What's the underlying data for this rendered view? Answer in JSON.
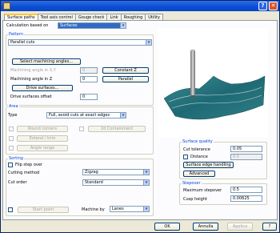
{
  "dialog": {
    "help_glyph": "?",
    "close_glyph": "✕"
  },
  "tabs": [
    "Surface paths",
    "Tool axis control",
    "Gouge check",
    "Link",
    "Roughing",
    "Utility"
  ],
  "calc": {
    "label": "Calculation based on",
    "value": "Surfaces"
  },
  "pattern": {
    "title": "Pattern",
    "type": "Parallel cuts",
    "select_angles_btn": "Select machining angles...",
    "angle_xy_label": "Machining angle in X,Y",
    "angle_xy_value": "0",
    "constant_z_btn": "Constant Z",
    "angle_z_label": "Machining angle in Z",
    "angle_z_value": "0",
    "parallel_btn": "Parallel",
    "drive_btn": "Drive surfaces...",
    "offset_label": "Drive surfaces offset",
    "offset_value": "0"
  },
  "area": {
    "title": "Area",
    "type_label": "Type",
    "type_value": "Full, avoid cuts at exact edges",
    "round_corners_btn": "Round corners",
    "containment_btn": "2d Containment",
    "extend_btn": "Extend / trim",
    "angle_range_btn": "Angle range"
  },
  "sorting": {
    "title": "Sorting",
    "flip_label": "Flip step over",
    "method_label": "Cutting method",
    "method_value": "Zigzag",
    "order_label": "Cut order",
    "order_value": "Standard",
    "start_btn": "Start point",
    "machine_label": "Machine by",
    "machine_value": "Lanes"
  },
  "quality": {
    "title": "Surface quality",
    "tol_label": "Cut tolerance",
    "tol_value": "0.05",
    "dist_label": "Distance",
    "dist_value": "0.5",
    "edge_btn": "Surface edge handling",
    "adv_btn": "Advanced"
  },
  "stepover": {
    "title": "Stepover",
    "max_label": "Maximum stepover",
    "max_value": "0.5",
    "cusp_label": "Cusp height",
    "cusp_value": "0.00625"
  },
  "footer": {
    "ok": "OK",
    "cancel": "Annulla",
    "apply": "Applica",
    "help": "?"
  }
}
